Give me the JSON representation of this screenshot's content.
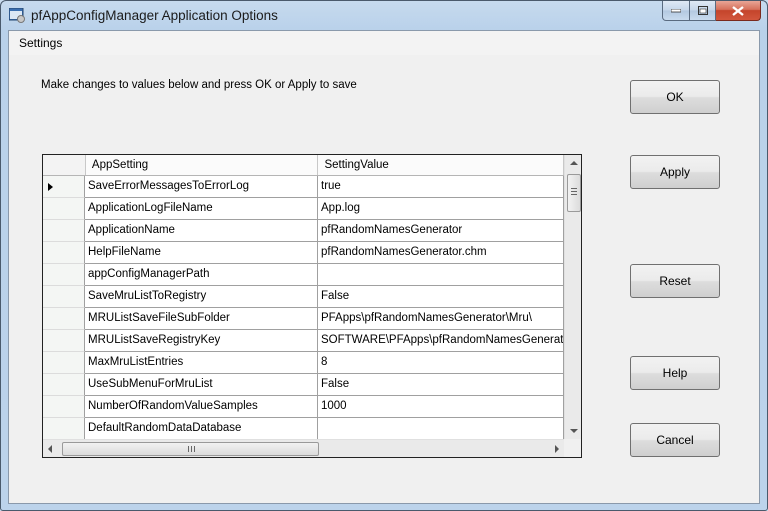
{
  "window": {
    "title": "pfAppConfigManager Application Options",
    "controls": {
      "minimize": "minimize",
      "maximize": "maximize",
      "close": "close"
    }
  },
  "menu": {
    "items": [
      {
        "label": "Settings"
      }
    ]
  },
  "instructions": "Make changes to values below and press OK or Apply to save",
  "grid": {
    "columns": [
      "AppSetting",
      "SettingValue"
    ],
    "current_row": 0,
    "rows": [
      {
        "setting": "SaveErrorMessagesToErrorLog",
        "value": "true"
      },
      {
        "setting": "ApplicationLogFileName",
        "value": "App.log"
      },
      {
        "setting": "ApplicationName",
        "value": "pfRandomNamesGenerator"
      },
      {
        "setting": "HelpFileName",
        "value": "pfRandomNamesGenerator.chm"
      },
      {
        "setting": "appConfigManagerPath",
        "value": ""
      },
      {
        "setting": "SaveMruListToRegistry",
        "value": "False"
      },
      {
        "setting": "MRUListSaveFileSubFolder",
        "value": "PFApps\\pfRandomNamesGenerator\\Mru\\"
      },
      {
        "setting": "MRUListSaveRegistryKey",
        "value": "SOFTWARE\\PFApps\\pfRandomNamesGenerator"
      },
      {
        "setting": "MaxMruListEntries",
        "value": "8"
      },
      {
        "setting": "UseSubMenuForMruList",
        "value": "False"
      },
      {
        "setting": "NumberOfRandomValueSamples",
        "value": "1000"
      },
      {
        "setting": "DefaultRandomDataDatabase",
        "value": ""
      }
    ]
  },
  "buttons": {
    "ok": "OK",
    "apply": "Apply",
    "reset": "Reset",
    "help": "Help",
    "cancel": "Cancel"
  }
}
